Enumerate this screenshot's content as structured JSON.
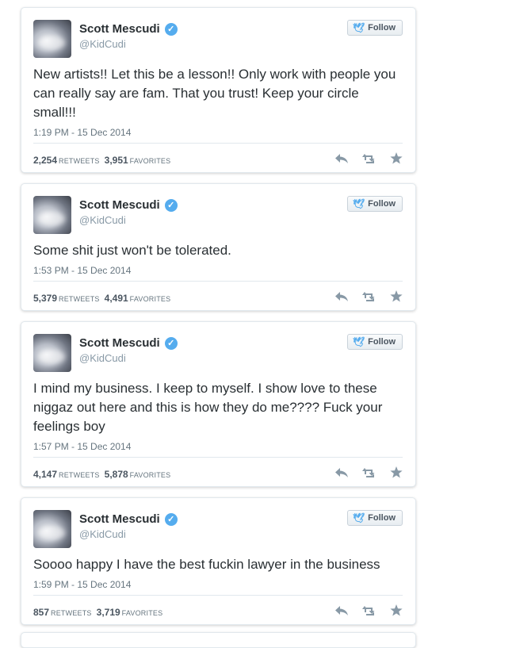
{
  "tweets": [
    {
      "name": "Scott Mescudi",
      "handle": "@KidCudi",
      "follow_label": "Follow",
      "text": "New artists!! Let this be a lesson!! Only work with people you can really say are fam. That you trust! Keep your circle small!!!",
      "time": "1:19 PM - 15 Dec 2014",
      "retweets": "2,254",
      "retweets_label": "RETWEETS",
      "favorites": "3,951",
      "favorites_label": "FAVORITES"
    },
    {
      "name": "Scott Mescudi",
      "handle": "@KidCudi",
      "follow_label": "Follow",
      "text": "Some shit just won't be tolerated.",
      "time": "1:53 PM - 15 Dec 2014",
      "retweets": "5,379",
      "retweets_label": "RETWEETS",
      "favorites": "4,491",
      "favorites_label": "FAVORITES"
    },
    {
      "name": "Scott Mescudi",
      "handle": "@KidCudi",
      "follow_label": "Follow",
      "text": "I mind my business. I keep to myself. I show love to these niggaz out here and this is how they do me???? Fuck your feelings boy",
      "time": "1:57 PM - 15 Dec 2014",
      "retweets": "4,147",
      "retweets_label": "RETWEETS",
      "favorites": "5,878",
      "favorites_label": "FAVORITES"
    },
    {
      "name": "Scott Mescudi",
      "handle": "@KidCudi",
      "follow_label": "Follow",
      "text": "Soooo happy I have the best fuckin lawyer in the business",
      "time": "1:59 PM - 15 Dec 2014",
      "retweets": "857",
      "retweets_label": "RETWEETS",
      "favorites": "3,719",
      "favorites_label": "FAVORITES"
    }
  ],
  "icons": {
    "verified": "verified-badge-icon",
    "bird": "twitter-bird-icon",
    "reply": "reply-icon",
    "retweet": "retweet-icon",
    "favorite": "star-icon"
  },
  "colors": {
    "accent": "#55acee",
    "text": "#292f33",
    "muted": "#66757f",
    "border": "#e1e8ed"
  }
}
